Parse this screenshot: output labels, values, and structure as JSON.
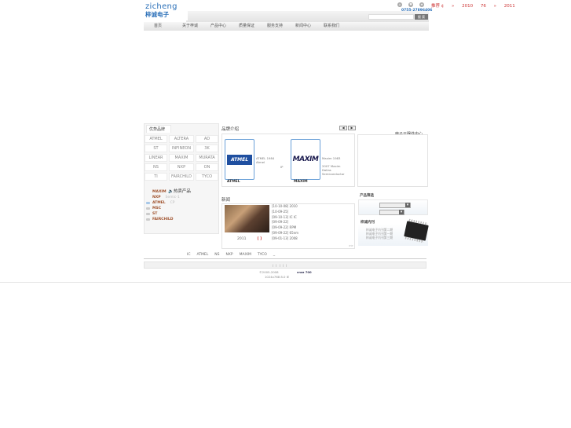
{
  "ticker": {
    "items": [
      "推荐 ¢",
      "»",
      "2010",
      "76",
      "»",
      "2011"
    ]
  },
  "header": {
    "logo_en": "zicheng",
    "logo_cn": "梓诚电子",
    "phone": "0755-27896406",
    "search_placeholder": "",
    "search_button": "搜 索",
    "icons": [
      "home-icon",
      "favorite-icon",
      "star-icon"
    ]
  },
  "nav": {
    "items": [
      "首页",
      "关于梓诚",
      "产品中心",
      "质量保证",
      "服务支持",
      "新闻中心",
      "联系我们"
    ]
  },
  "brands": {
    "title": "优势品牌",
    "grid": [
      "ATMEL",
      "ALTERA",
      "AD",
      "ST",
      "INFINEON",
      "3K",
      "LINEAR",
      "MAXIM",
      "MURATA",
      "NS",
      "NXP",
      "ON",
      "TI",
      "FAIRCHILD",
      "TYCO"
    ],
    "hot_title": "热卖产品",
    "hot_items": [
      {
        "name": "MAXIM",
        "extra": ""
      },
      {
        "name": "NXP",
        "extra": "Semic-1"
      },
      {
        "name": "ATMEL",
        "extra": "CP"
      },
      {
        "name": "MSC",
        "extra": ""
      },
      {
        "name": "ST",
        "extra": ""
      },
      {
        "name": "FAIRCHILD",
        "extra": ""
      }
    ]
  },
  "intro": {
    "title": "品牌介绍",
    "prev": "◀",
    "next": "▶",
    "cards": [
      {
        "logo": "ATMEL",
        "caption": "ATMEL",
        "desc": [
          "ATMEL 1984",
          "",
          "Atmel",
          "",
          "IP"
        ]
      },
      {
        "logo": "MAXIM",
        "caption": "MAXIM",
        "desc": [
          "Maxim 1983",
          "",
          "2007 Maxim",
          "Dallas",
          "Semiconductor"
        ]
      }
    ]
  },
  "right": {
    "title": "电子元器件中心"
  },
  "news": {
    "title": "新闻",
    "photo_caption": "2011",
    "photo_caption_red": "[ ]",
    "rows": [
      "[10-10-08]      2010   ",
      "[10-09-25]",
      "[09-10-13]     IC  IC",
      "[09-09-22]",
      "[09-09-22]           RPM",
      "[09-09-22] 65nm",
      "[09-01-13]    2008"
    ],
    "more": ">>"
  },
  "filter": {
    "title": "产品筛选"
  },
  "magazine": {
    "title": "梓诚内刊",
    "rows": [
      "梓诚电子内刊第二期",
      "梓诚电子内刊第一期",
      "梓诚电子内刊第三期"
    ]
  },
  "footer": {
    "links": [
      "IC",
      "ATMEL",
      "NS",
      "NXP",
      "MAXIM",
      "TYCO",
      "_"
    ],
    "nav": "| | | | |",
    "copyright": "©2005-2008",
    "badge": "cnzz 700",
    "resolution": "1024x768      8.0     IE"
  }
}
